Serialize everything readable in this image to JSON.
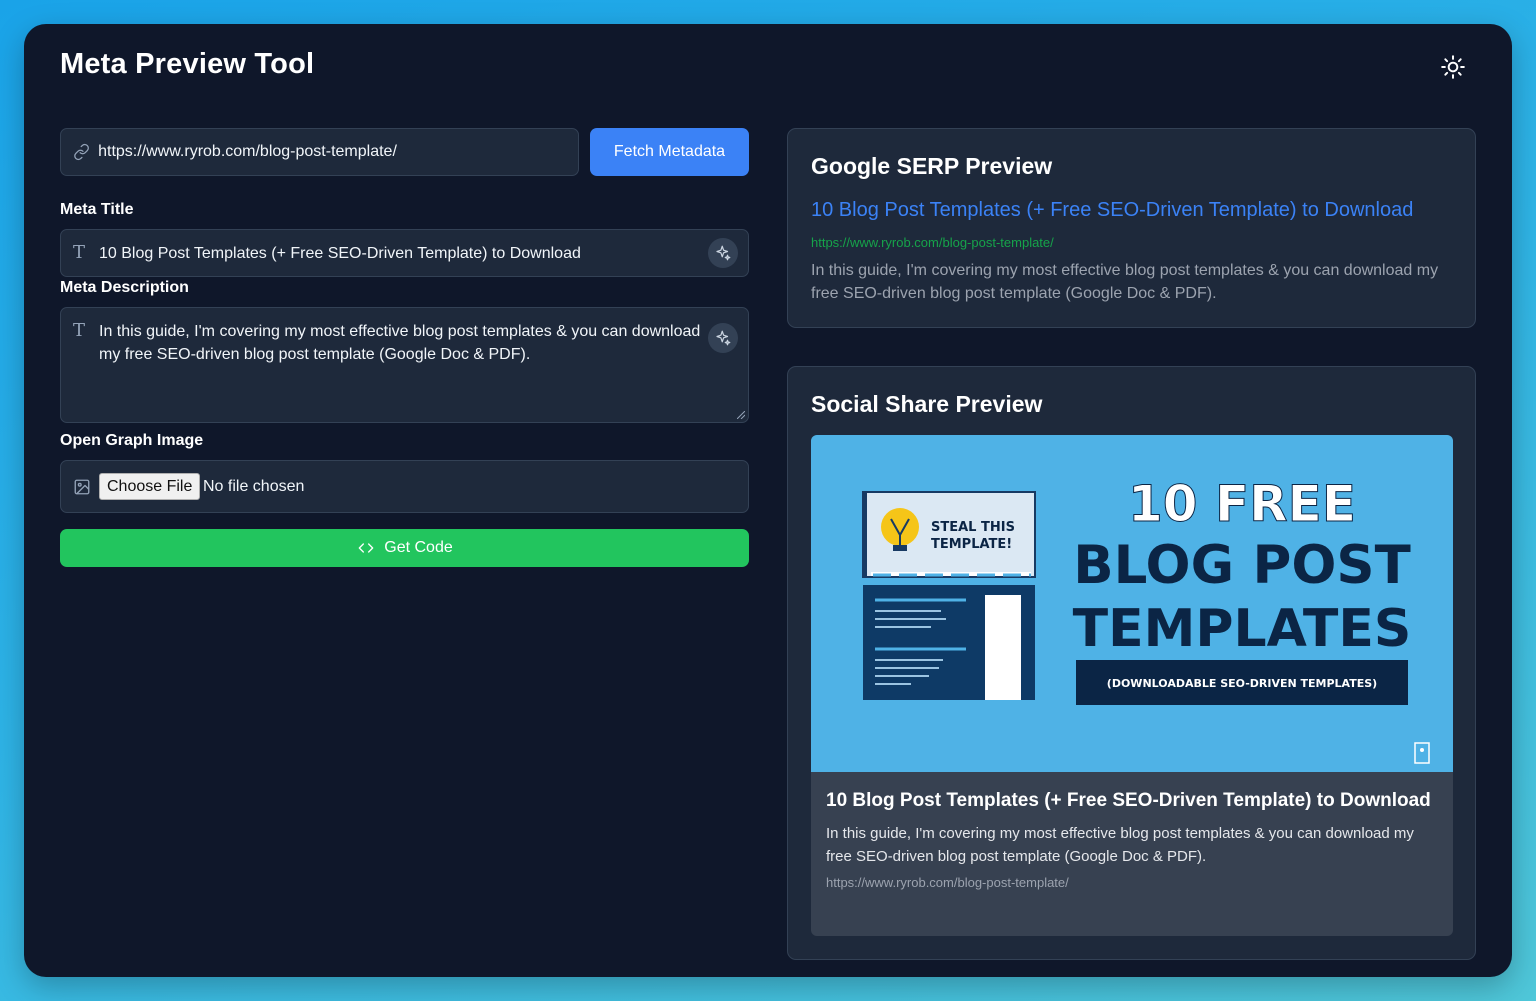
{
  "app": {
    "title": "Meta Preview Tool",
    "theme_toggle_icon": "sun-icon"
  },
  "url_input": {
    "value": "https://www.ryrob.com/blog-post-template/",
    "icon": "link-icon"
  },
  "fetch_button": {
    "label": "Fetch Metadata",
    "color": "#3b82f6"
  },
  "meta_title": {
    "label": "Meta Title",
    "value": "10 Blog Post Templates (+ Free SEO-Driven Template) to Download"
  },
  "meta_description": {
    "label": "Meta Description",
    "value": "In this guide, I'm covering my most effective blog post templates & you can download my free SEO-driven blog post template (Google Doc & PDF)."
  },
  "og_image": {
    "label": "Open Graph Image",
    "choose_file_label": "Choose File",
    "no_file_text": "No file chosen"
  },
  "get_code_button": {
    "label": "Get Code",
    "color": "#22c55e"
  },
  "serp_preview": {
    "heading": "Google SERP Preview",
    "title": "10 Blog Post Templates (+ Free SEO-Driven Template) to Download",
    "url": "https://www.ryrob.com/blog-post-template/",
    "description": "In this guide, I'm covering my most effective blog post templates & you can download my free SEO-driven blog post template (Google Doc & PDF)."
  },
  "social_preview": {
    "heading": "Social Share Preview",
    "image": {
      "sticker": "STEAL THIS TEMPLATE!",
      "line1": "10 FREE",
      "line2": "BLOG POST",
      "line3": "TEMPLATES",
      "banner": "(DOWNLOADABLE SEO-DRIVEN TEMPLATES)"
    },
    "title": "10 Blog Post Templates (+ Free SEO-Driven Template) to Download",
    "description": "In this guide, I'm covering my most effective blog post templates & you can download my free SEO-driven blog post template (Google Doc & PDF).",
    "url": "https://www.ryrob.com/blog-post-template/"
  }
}
